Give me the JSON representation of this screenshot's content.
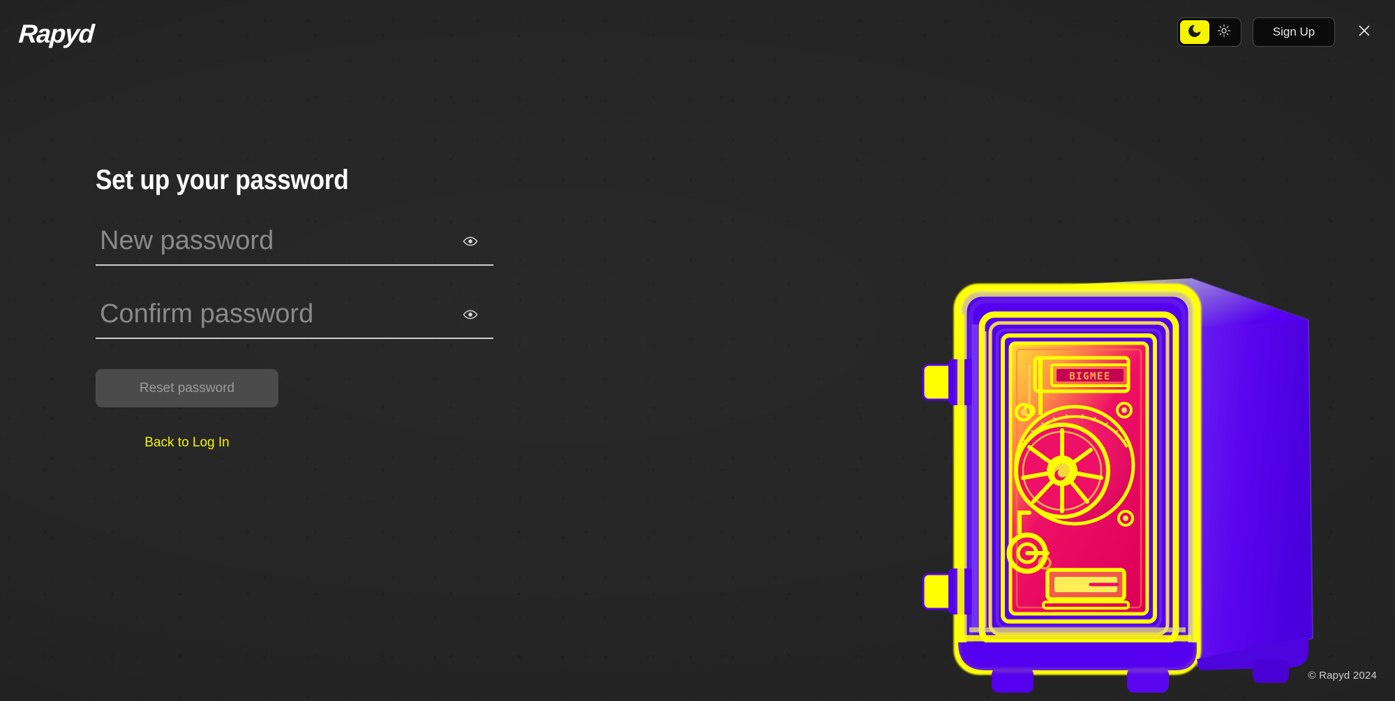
{
  "brand": {
    "logo_text": "Rapyd",
    "accent_yellow": "#F5F400",
    "background": "#242424",
    "safe_magenta": "#EE0066",
    "safe_purple": "#5500EE",
    "safe_yellow": "#FFFF00"
  },
  "header": {
    "theme_toggle": {
      "dark_icon": "moon-icon",
      "light_icon": "sun-icon",
      "active": "dark"
    },
    "signup_label": "Sign Up",
    "close_icon": "close-icon"
  },
  "main": {
    "title": "Set up your password",
    "fields": [
      {
        "name": "new-password",
        "placeholder": "New password",
        "value": "",
        "toggle_icon": "eye-icon"
      },
      {
        "name": "confirm-password",
        "placeholder": "Confirm password",
        "value": "",
        "toggle_icon": "eye-icon"
      }
    ],
    "submit_label": "Reset password",
    "submit_disabled": true,
    "back_link_label": "Back to Log In"
  },
  "illustration": {
    "name": "thermal-safe-illustration",
    "display_text": "BIGMEE"
  },
  "footer": {
    "copyright": "© Rapyd 2024"
  }
}
